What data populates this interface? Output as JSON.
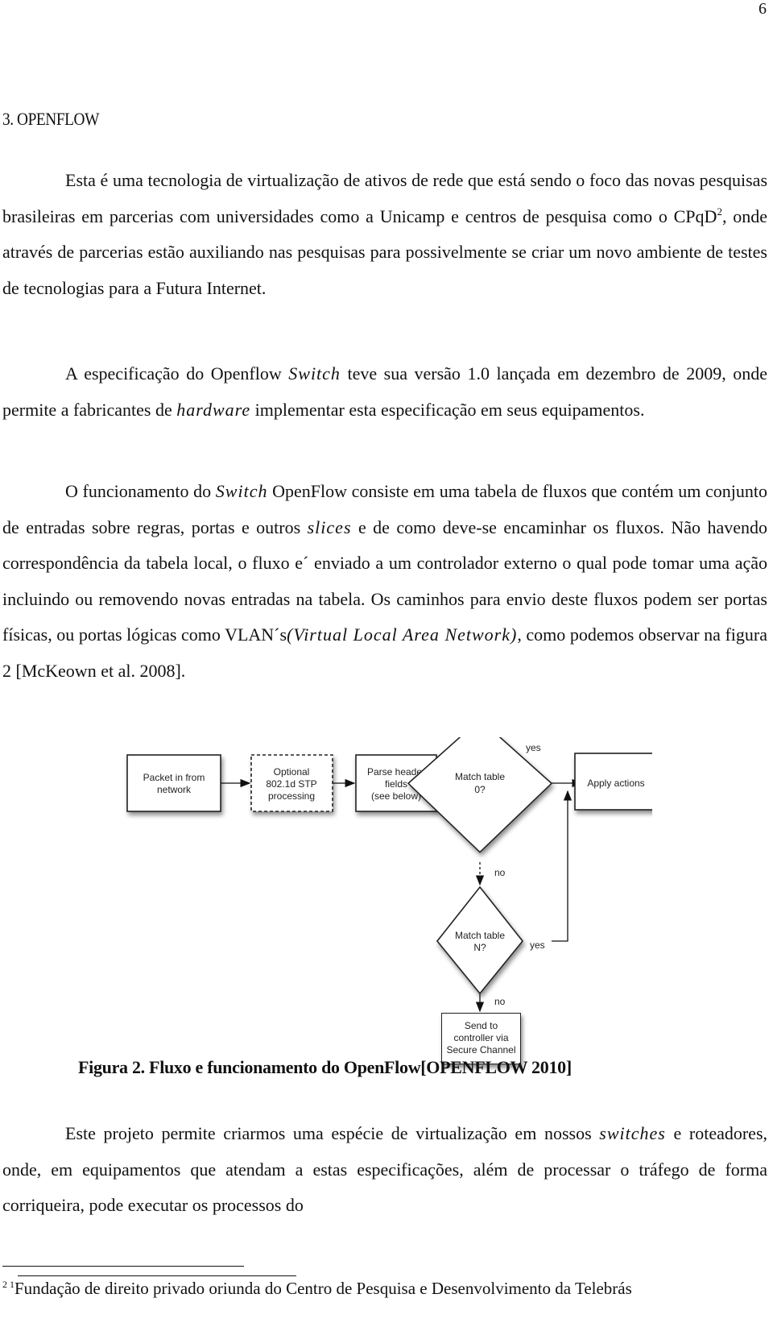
{
  "page": {
    "number": "6",
    "section_title": "3. OPENFLOW"
  },
  "paragraphs": {
    "p1": {
      "a": "Esta é uma tecnologia de virtualização de ativos de rede que está sendo o foco das novas pesquisas brasileiras em parcerias com universidades como a Unicamp e centros de pesquisa como o CPqD",
      "sup": "2",
      "b": ", onde através de parcerias estão auxiliando nas pesquisas para possivelmente se criar um novo ambiente de testes de tecnologias para a Futura Internet."
    },
    "p2": {
      "a": "A especificação do Openflow ",
      "i1": "Switch",
      "b": " teve sua versão 1.0 lançada em dezembro de 2009, onde permite a fabricantes de ",
      "i2": "hardware",
      "c": " implementar esta especificação em seus equipamentos."
    },
    "p3": {
      "a": "O funcionamento do ",
      "i1": "Switch",
      "b": " OpenFlow consiste em uma tabela de fluxos que contém um conjunto de entradas sobre regras, portas e outros ",
      "i2": "slices",
      "c": " e de como deve-se encaminhar os fluxos. Não havendo correspondência da tabela local, o fluxo e´ enviado a um controlador externo o qual pode tomar uma ação incluindo ou removendo novas entradas na tabela. Os caminhos para envio deste fluxos podem ser portas físicas, ou portas lógicas como VLAN´s",
      "i3": "(Virtual Local Area Network)",
      "d": ", como podemos observar na figura 2 [McKeown et al. 2008]."
    },
    "p4": {
      "i1": "switches",
      "a": "Este projeto permite criarmos uma espécie de virtualização em nossos ",
      "b": " e roteadores, onde, em equipamentos que atendam a estas especificações, além de processar o tráfego de forma corriqueira, pode executar os processos do"
    }
  },
  "figure": {
    "caption": "Figura 2. Fluxo e funcionamento do OpenFlow[OPENFLOW 2010]",
    "nodes": {
      "packet_in": [
        "Packet in from",
        "network"
      ],
      "stp": [
        "Optional",
        "802.1d STP",
        "processing"
      ],
      "parse": [
        "Parse header",
        "fields",
        "(see below)"
      ],
      "match0": [
        "Match table",
        "0?"
      ],
      "apply": [
        "Apply actions"
      ],
      "matchN": [
        "Match table",
        "N?"
      ],
      "controller": [
        "Send to",
        "controller via",
        "Secure Channel"
      ]
    },
    "edge_labels": {
      "yes_top": "yes",
      "no_top": "no",
      "yes_bottom": "yes",
      "no_bottom": "no"
    }
  },
  "footnote": {
    "marks": "2 1",
    "text": "Fundação de direito privado oriunda do Centro de Pesquisa e Desenvolvimento da Telebrás"
  }
}
